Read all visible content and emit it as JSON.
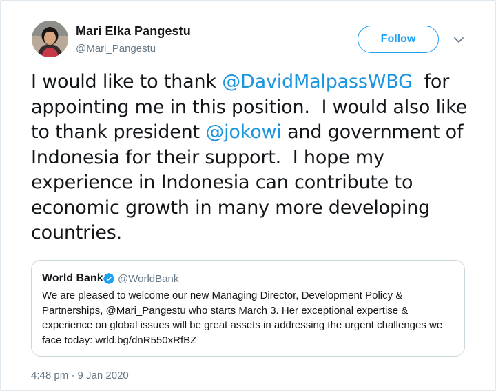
{
  "author": {
    "name": "Mari Elka Pangestu",
    "handle": "@Mari_Pangestu"
  },
  "follow_button": {
    "label": "Follow"
  },
  "icons": {
    "caret": "chevron-down-icon",
    "verified": "verified-badge-icon",
    "avatar": "profile-photo"
  },
  "tweet": {
    "parts": [
      "I would like to thank ",
      "@DavidMalpassWBG",
      "  for appointing me in this position.  I would also like to thank president ",
      "@jokowi",
      " and government of Indonesia for their support.  I hope my experience in Indonesia can contribute to economic growth in many more developing countries."
    ],
    "timestamp": "4:48 pm - 9 Jan 2020"
  },
  "quoted_tweet": {
    "name": "World Bank",
    "handle": "@WorldBank",
    "text": "We are pleased to welcome our new Managing Director, Development Policy & Partnerships, @Mari_Pangestu who starts March 3. Her exceptional expertise & experience on global issues will be great assets in addressing the urgent challenges we face today: wrld.bg/dnR550xRfBZ"
  },
  "colors": {
    "link": "#1b95e0",
    "follow_blue": "#1da1f2",
    "secondary_text": "#657786",
    "border": "#ccd6dd"
  }
}
